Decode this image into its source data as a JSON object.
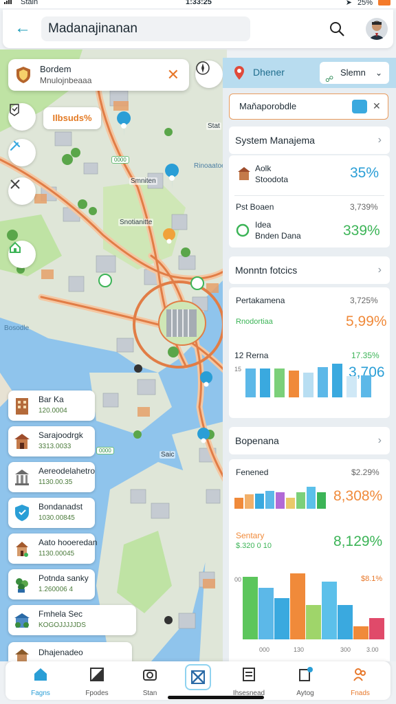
{
  "status_bar": {
    "carrier": "Stain",
    "time": "1:33:25",
    "battery": "25%"
  },
  "header": {
    "title": "Madanajinanan"
  },
  "map": {
    "location_card": {
      "title": "Bordem",
      "subtitle": "Mnulojnbeaaa"
    },
    "tag_label": "Ilbsuds%",
    "labels": [
      {
        "text": "Stat"
      },
      {
        "text": "Smniten"
      },
      {
        "text": "Snotianitte"
      },
      {
        "text": "Saic"
      }
    ],
    "green_badges": [
      "0000",
      "0000"
    ],
    "water_labels": [
      "Rinoaatoe",
      "Bosodle"
    ]
  },
  "places": [
    {
      "name": "Bar Ka",
      "code": "120.0004",
      "icon": "building-icon",
      "color": "#b46a3a"
    },
    {
      "name": "Sarajoodrgk",
      "code": "3313.0033",
      "icon": "temple-icon",
      "color": "#9e4d2c"
    },
    {
      "name": "Aereodelahetro",
      "code": "1130.00.35",
      "icon": "museum-icon",
      "color": "#6a6a6a"
    },
    {
      "name": "Bondanadst",
      "code": "1030.00845",
      "icon": "shield-icon",
      "color": "#2a9ed6"
    },
    {
      "name": "Aato hooeredan",
      "code": "1130.00045",
      "icon": "church-icon",
      "color": "#a35a2d"
    },
    {
      "name": "Potnda sanky",
      "code": "1.260006 4",
      "icon": "plant-icon",
      "color": "#3a8d3e"
    },
    {
      "name": "Fmhela Sec",
      "code": "KOGOJJJJJDS",
      "icon": "store-icon",
      "color": "#2a6aa6"
    },
    {
      "name": "Dhajenadeo",
      "code": "",
      "icon": "house-icon",
      "color": "#8a5a2a"
    }
  ],
  "panel": {
    "header_title": "Dhener",
    "dropdown_label": "Slemn",
    "filter_text": "Maňaporobdle",
    "sections": [
      {
        "title": "System Manajema"
      },
      {
        "title": "Monntn fotcics"
      },
      {
        "title": "Bopenana"
      }
    ],
    "card1": {
      "row1_label1": "Aolk",
      "row1_label2": "Stoodota",
      "row1_value": "35%",
      "row2_title": "Pst Boaen",
      "row2_small": "3,739%",
      "row2_label1": "Idea",
      "row2_label2": "Bnden Dana",
      "row2_value": "339%"
    },
    "card2": {
      "title": "Pertakamena",
      "small1": "3,725%",
      "sub": "Rnodortiaa",
      "value1": "5,99%",
      "row2_label": "12 Rerna",
      "small2": "17.35%",
      "value2": "3,706",
      "axis_left": "15"
    },
    "card3": {
      "title": "Fenened",
      "small1": "$2.29%",
      "value1": "8,308%",
      "label2": "Sentary",
      "sub2": "$.320 0 10",
      "value2": "8,129%",
      "small3": "$8.1%",
      "axis_left": "00",
      "x_ticks": [
        "000",
        "130",
        "300",
        "3.00"
      ]
    },
    "colors": {
      "orange": "#f08a3a",
      "blue": "#3aa9df",
      "green": "#3cb457"
    },
    "mini_bars_1": [
      {
        "v": 0.8,
        "c": "#5cb8e8"
      },
      {
        "v": 0.8,
        "c": "#3aa9df"
      },
      {
        "v": 0.8,
        "c": "#7bd07a"
      },
      {
        "v": 0.75,
        "c": "#f08a3a"
      },
      {
        "v": 0.7,
        "c": "#b8def2"
      },
      {
        "v": 0.85,
        "c": "#5cb8e8"
      },
      {
        "v": 0.95,
        "c": "#3aa9df"
      },
      {
        "v": 0.6,
        "c": "#cfe8f6"
      },
      {
        "v": 0.62,
        "c": "#5cb8e8"
      }
    ],
    "mini_bars_2": [
      {
        "v": 0.5,
        "c": "#f08a3a"
      },
      {
        "v": 0.65,
        "c": "#f2b06a"
      },
      {
        "v": 0.7,
        "c": "#3aa9df"
      },
      {
        "v": 0.8,
        "c": "#5cb8e8"
      },
      {
        "v": 0.75,
        "c": "#b26ad6"
      },
      {
        "v": 0.5,
        "c": "#e9c96a"
      },
      {
        "v": 0.75,
        "c": "#7bd07a"
      },
      {
        "v": 1.0,
        "c": "#5cc0ea"
      },
      {
        "v": 0.75,
        "c": "#3cb457"
      }
    ],
    "big_bars": [
      {
        "v": 0.95,
        "c": "#5cc65c"
      },
      {
        "v": 0.78,
        "c": "#5cb8e8"
      },
      {
        "v": 0.62,
        "c": "#3aa9df"
      },
      {
        "v": 1.0,
        "c": "#f08a3a"
      },
      {
        "v": 0.52,
        "c": "#9fd56a"
      },
      {
        "v": 0.88,
        "c": "#5cc0ea"
      },
      {
        "v": 0.52,
        "c": "#3aa9df"
      },
      {
        "v": 0.2,
        "c": "#f08a3a"
      },
      {
        "v": 0.32,
        "c": "#e04a6a"
      }
    ]
  },
  "nav": [
    {
      "label": "Fagns",
      "icon": "home-icon"
    },
    {
      "label": "Fpodes",
      "icon": "layers-icon"
    },
    {
      "label": "Stan",
      "icon": "camera-icon"
    },
    {
      "label": "",
      "icon": "scan-icon"
    },
    {
      "label": "Ihsesnead",
      "icon": "list-icon"
    },
    {
      "label": "Aytog",
      "icon": "calendar-icon"
    },
    {
      "label": "Fnads",
      "icon": "friends-icon"
    }
  ]
}
